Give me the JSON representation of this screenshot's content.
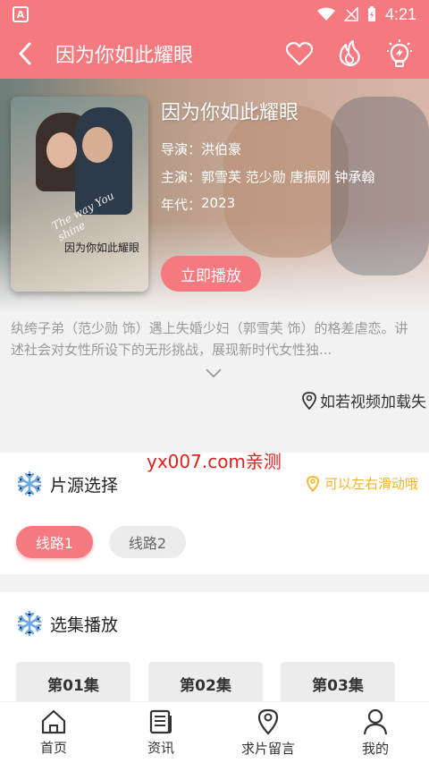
{
  "status_bar": {
    "time": "4:21"
  },
  "header": {
    "title": "因为你如此耀眼"
  },
  "movie": {
    "title": "因为你如此耀眼",
    "director_label": "导演：",
    "director": "洪伯豪",
    "cast_label": "主演：",
    "cast": "郭雪芙 范少勋 唐振刚 钟承翰",
    "year_label": "年代：",
    "year": "2023",
    "play_label": "立即播放",
    "poster_script": "The way You shine",
    "poster_title": "因为你如此耀眼",
    "description": "纨绔子弟（范少勋 饰）遇上失婚少妇（郭雪芙 饰）的格差虐恋。讲述社会对女性所设下的无形挑战，展现新时代女性独..."
  },
  "report": {
    "label": "如若视频加载失"
  },
  "watermark": "yx007.com亲测",
  "sources": {
    "title": "片源选择",
    "hint": "可以左右滑动哦",
    "routes": [
      "线路1",
      "线路2"
    ]
  },
  "episodes": {
    "title": "选集播放",
    "items": [
      "第01集",
      "第02集",
      "第03集"
    ]
  },
  "bottom_nav": {
    "items": [
      "首页",
      "资讯",
      "求片留言",
      "我的"
    ]
  },
  "colors": {
    "accent": "#f47a80",
    "hint": "#f5b32a",
    "snowflake": "#6aa8e8"
  }
}
